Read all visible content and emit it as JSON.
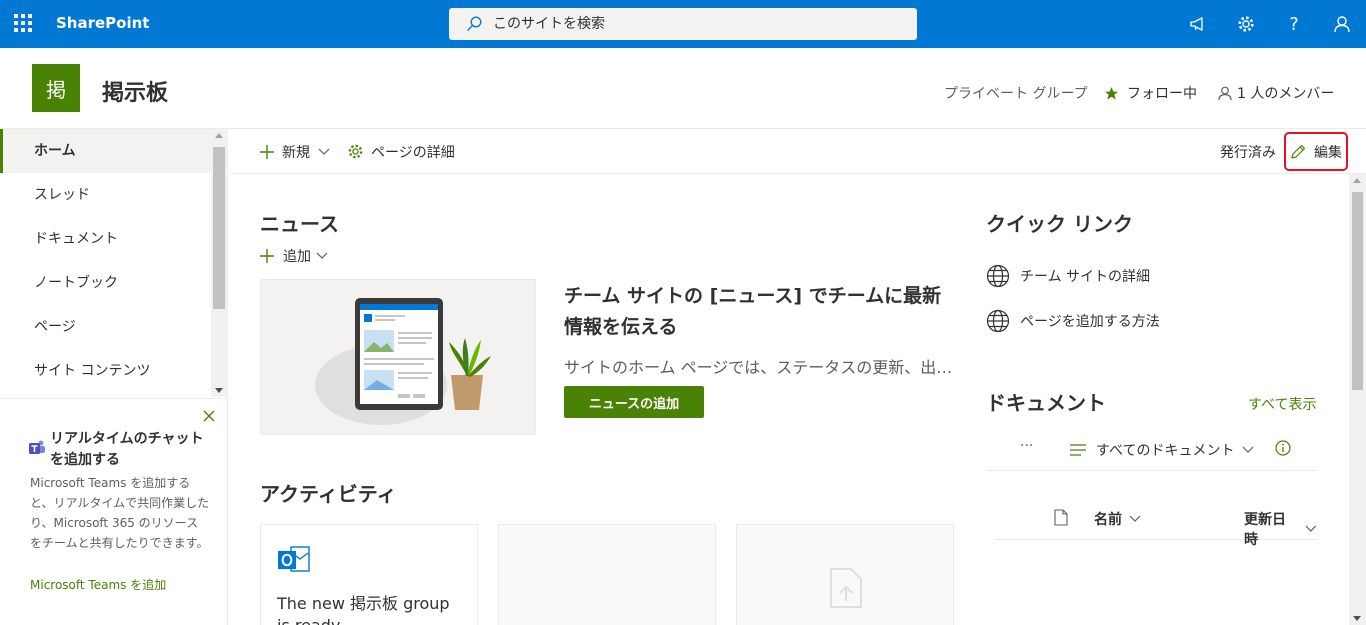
{
  "suitebar": {
    "brand": "SharePoint",
    "search_placeholder": "このサイトを検索",
    "icons": [
      "waffle-icon",
      "search-icon",
      "megaphone-icon",
      "gear-icon",
      "help-icon",
      "person-icon"
    ],
    "help_glyph": "?"
  },
  "site": {
    "logo_text": "掲",
    "title": "掲示板",
    "group_type": "プライベート グループ",
    "follow_label": "フォロー中",
    "members_label": "1 人のメンバー"
  },
  "nav": {
    "items": [
      {
        "label": "ホーム",
        "active": true
      },
      {
        "label": "スレッド"
      },
      {
        "label": "ドキュメント"
      },
      {
        "label": "ノートブック"
      },
      {
        "label": "ページ"
      },
      {
        "label": "サイト コンテンツ"
      }
    ]
  },
  "teams_promo": {
    "title": "リアルタイムのチャットを追加する",
    "description": "Microsoft Teams を追加すると、リアルタイムで共同作業したり、Microsoft 365 のリソースをチームと共有したりできます。",
    "link": "Microsoft Teams を追加"
  },
  "commandbar": {
    "new_label": "新規",
    "page_details_label": "ページの詳細",
    "status": "発行済み",
    "edit_label": "編集"
  },
  "news": {
    "title": "ニュース",
    "add_label": "追加",
    "heading": "チーム サイトの [ニュース] でチームに最新情報を伝える",
    "description": "サイトのホーム ページでは、ステータスの更新、出張レポートなど",
    "button": "ニュースの追加"
  },
  "activity": {
    "title": "アクティビティ",
    "card_text": "The new 掲示板 group is ready"
  },
  "quick_links": {
    "title": "クイック リンク",
    "items": [
      "チーム サイトの詳細",
      "ページを追加する方法"
    ]
  },
  "documents": {
    "title": "ドキュメント",
    "see_all": "すべて表示",
    "more": "···",
    "view_label": "すべてのドキュメント",
    "col_name": "名前",
    "col_modified": "更新日時"
  },
  "colors": {
    "suitebar": "#0078d4",
    "accent": "#498205",
    "highlight": "#e81123"
  }
}
